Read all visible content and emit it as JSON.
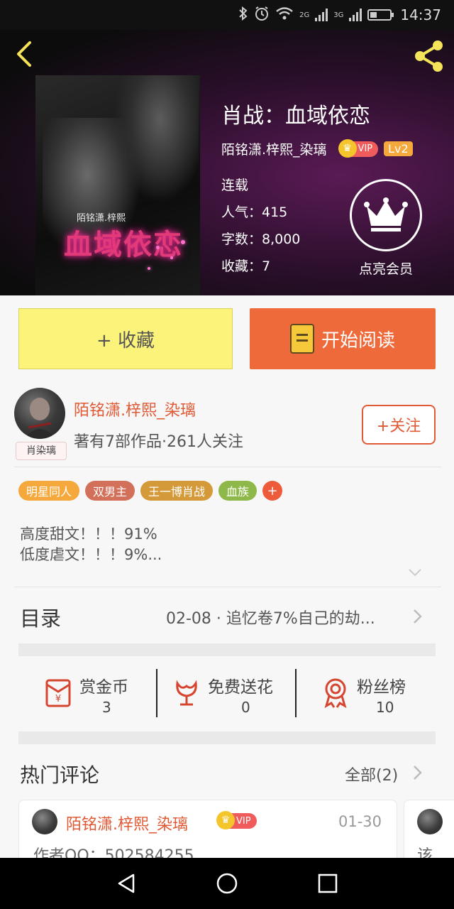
{
  "status_bar": {
    "time": "14:37",
    "network_1": "2G",
    "network_2": "3G",
    "battery_level": 0.35,
    "icons": [
      "bluetooth-icon",
      "alarm-icon",
      "wifi-icon",
      "signal-icon",
      "battery-icon"
    ]
  },
  "header": {
    "back_icon": "back-arrow-icon",
    "share_icon": "share-icon",
    "book_title": "肖战：血域依恋",
    "author": "陌铭潇.梓熙_染璃",
    "vip_badge": "VIP",
    "level_badge": "Lv2",
    "status": "连载",
    "popularity": "人气：415",
    "word_count": "字数：8,000",
    "favorites": "收藏：7",
    "vip_cta": "点亮会员",
    "cover": {
      "title": "血域依恋",
      "subtitle": "陌铭潇.梓熙"
    }
  },
  "actions": {
    "collect_label": "+ 收藏",
    "read_label": "开始阅读"
  },
  "author_card": {
    "name": "陌铭潇.梓熙_染璃",
    "stats": "著有7部作品·261人关注",
    "avatar_tag": "肖染璃",
    "follow_label": "+关注"
  },
  "tags": [
    {
      "label": "明星同人",
      "color": "#f5a93c"
    },
    {
      "label": "双男主",
      "color": "#d2705a"
    },
    {
      "label": "王一博肖战",
      "color": "#d49a3a"
    },
    {
      "label": "血族",
      "color": "#8fb84a"
    }
  ],
  "tag_add": "+",
  "description": {
    "line1": "高度甜文！！！91%",
    "line2": "低度虐文！！！9%..."
  },
  "toc": {
    "label": "目录",
    "latest": "02-08 · 追忆卷7%自己的劫..."
  },
  "stats": [
    {
      "name": "赏金币",
      "value": "3",
      "icon": "red-envelope-icon"
    },
    {
      "name": "免费送花",
      "value": "0",
      "icon": "flower-icon"
    },
    {
      "name": "粉丝榜",
      "value": "10",
      "icon": "medal-icon"
    }
  ],
  "comments": {
    "section_title": "热门评论",
    "all_link": "全部(2)",
    "items": [
      {
        "author": "陌铭潇.梓熙_染璃",
        "vip": "VIP",
        "date": "01-30",
        "text": "作者QQ：502584255"
      },
      {
        "text": "该"
      }
    ]
  },
  "navbar": [
    "back-triangle-icon",
    "home-circle-icon",
    "recents-square-icon"
  ],
  "colors": {
    "accent_orange": "#ee6a3b",
    "collect_yellow": "#fbf37a",
    "author_red": "#e05a35"
  }
}
